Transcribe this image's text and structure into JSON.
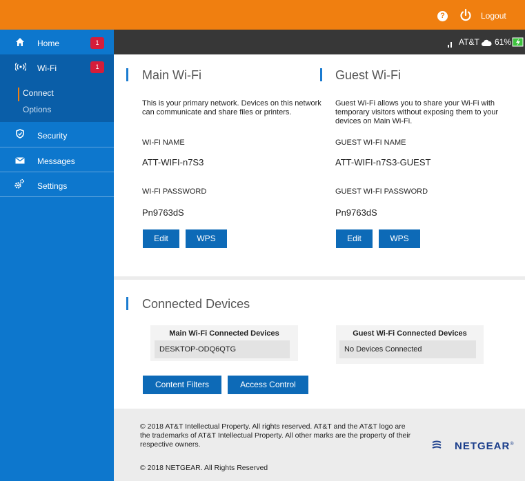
{
  "header": {
    "help_icon": "?",
    "logout_label": "Logout"
  },
  "status": {
    "carrier": "AT&T",
    "battery_percent": "61%"
  },
  "sidebar": {
    "items": [
      {
        "label": "Home",
        "badge": "1",
        "icon": "home-icon"
      },
      {
        "label": "Wi-Fi",
        "badge": "1",
        "icon": "wifi-icon"
      },
      {
        "label": "Security",
        "icon": "shield-icon"
      },
      {
        "label": "Messages",
        "icon": "envelope-icon"
      },
      {
        "label": "Settings",
        "icon": "gears-icon"
      }
    ],
    "wifi_subitems": [
      {
        "label": "Connect",
        "active": true
      },
      {
        "label": "Options",
        "active": false
      }
    ]
  },
  "main_wifi": {
    "title": "Main Wi-Fi",
    "description": "This is your primary network. Devices on this network can communicate and share files or printers.",
    "name_label": "WI-FI NAME",
    "name_value": "ATT-WIFI-n7S3",
    "password_label": "WI-FI PASSWORD",
    "password_value": "Pn9763dS",
    "edit_label": "Edit",
    "wps_label": "WPS"
  },
  "guest_wifi": {
    "title": "Guest Wi-Fi",
    "description": "Guest Wi-Fi allows you to share your Wi-Fi with temporary visitors without exposing them to your devices on Main Wi-Fi.",
    "name_label": "GUEST WI-FI NAME",
    "name_value": "ATT-WIFI-n7S3-GUEST",
    "password_label": "GUEST WI-FI PASSWORD",
    "password_value": "Pn9763dS",
    "edit_label": "Edit",
    "wps_label": "WPS"
  },
  "connected": {
    "title": "Connected Devices",
    "main_title": "Main Wi-Fi Connected Devices",
    "main_devices": [
      "DESKTOP-ODQ6QTG"
    ],
    "guest_title": "Guest Wi-Fi Connected Devices",
    "guest_empty": "No Devices Connected",
    "content_filters_label": "Content Filters",
    "access_control_label": "Access Control"
  },
  "footer": {
    "legal": "© 2018 AT&T Intellectual Property. All rights reserved. AT&T and the AT&T logo are the trademarks of AT&T Intellectual Property. All other marks are the property of their respective owners.",
    "copyright": "© 2018 NETGEAR. All Rights Reserved",
    "brand": "NETGEAR",
    "brand_mark": "®"
  },
  "colors": {
    "accent_orange": "#f07f10",
    "sidebar_blue": "#0d77cd",
    "button_blue": "#0d6ab7",
    "badge_red": "#d51d3a"
  }
}
